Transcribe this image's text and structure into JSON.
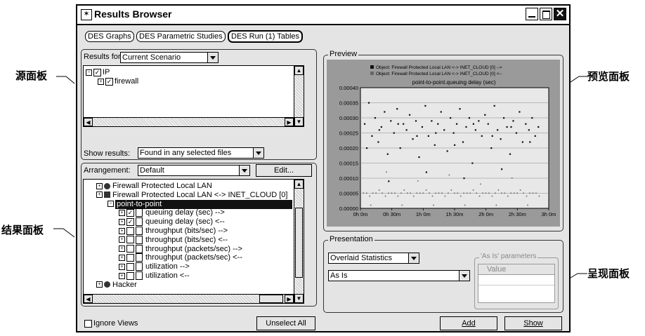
{
  "annotations": {
    "source_panel": "源面板",
    "results_panel": "结果面板",
    "preview_panel": "预览面板",
    "presentation_panel": "呈现面板"
  },
  "window": {
    "title": "Results Browser",
    "close_glyph": "✕"
  },
  "tabs": [
    "DES Graphs",
    "DES Parametric Studies",
    "DES Run (1) Tables"
  ],
  "source": {
    "results_for_label": "Results for:",
    "results_for_value": "Current Scenario",
    "tree": [
      {
        "label": "IP",
        "checked": true,
        "expanded": true,
        "level": 0
      },
      {
        "label": "firewall",
        "checked": true,
        "expanded": false,
        "level": 1
      }
    ],
    "show_results_label": "Show results:",
    "show_results_value": "Found in any selected files"
  },
  "results": {
    "arrangement_label": "Arrangement:",
    "arrangement_value": "Default",
    "edit_button": "Edit...",
    "items": [
      {
        "label": "Firewall Protected Local LAN",
        "level": 0,
        "kind": "node"
      },
      {
        "label": "Firewall Protected Local LAN <-> INET_CLOUD [0]",
        "level": 0,
        "kind": "link"
      },
      {
        "label": "point-to-point",
        "level": 1,
        "kind": "selected"
      },
      {
        "label": "queuing delay (sec) -->",
        "level": 2,
        "checked": true
      },
      {
        "label": "queuing delay (sec) <--",
        "level": 2,
        "checked": true
      },
      {
        "label": "throughput (bits/sec) -->",
        "level": 2,
        "checked": false
      },
      {
        "label": "throughput (bits/sec) <--",
        "level": 2,
        "checked": false
      },
      {
        "label": "throughput (packets/sec) -->",
        "level": 2,
        "checked": false
      },
      {
        "label": "throughput (packets/sec) <--",
        "level": 2,
        "checked": false
      },
      {
        "label": "utilization -->",
        "level": 2,
        "checked": false
      },
      {
        "label": "utilization <--",
        "level": 2,
        "checked": false
      },
      {
        "label": "Hacker",
        "level": 0,
        "kind": "node"
      }
    ],
    "ignore_views_label": "Ignore Views",
    "unselect_all_button": "Unselect All"
  },
  "preview": {
    "group_label": "Preview",
    "legend": [
      "Object: Firewall Protected Local LAN <-> INET_CLOUD [0] -->",
      "Object: Firewall Protected Local LAN <-> INET_CLOUD [0] <--"
    ]
  },
  "chart_data": {
    "type": "scatter",
    "title": "point-to-point.queuing delay (sec)",
    "ylim": [
      0,
      0.0004
    ],
    "yticks": [
      "0.00000",
      "0.00005",
      "0.00010",
      "0.00015",
      "0.00020",
      "0.00025",
      "0.00030",
      "0.00035",
      "0.00040"
    ],
    "xlim": [
      0,
      180
    ],
    "xticks": [
      "0h 0m",
      "0h 30m",
      "1h 0m",
      "1h 30m",
      "2h 0m",
      "2h 30m",
      "3h 0m"
    ],
    "grid": true,
    "legend_placement": "top",
    "series": [
      {
        "name": "Object: Firewall Protected Local LAN <-> INET_CLOUD [0] -->",
        "color": "#111111",
        "points": [
          [
            4,
            0.00028
          ],
          [
            8,
            0.00035
          ],
          [
            11,
            0.00024
          ],
          [
            14,
            0.0003
          ],
          [
            17,
            0.00022
          ],
          [
            20,
            0.00027
          ],
          [
            23,
            0.00032
          ],
          [
            26,
            0.00018
          ],
          [
            29,
            0.00029
          ],
          [
            32,
            0.00025
          ],
          [
            35,
            0.00033
          ],
          [
            38,
            0.0002
          ],
          [
            41,
            0.00028
          ],
          [
            44,
            0.00026
          ],
          [
            47,
            0.00031
          ],
          [
            50,
            0.00023
          ],
          [
            53,
            0.00029
          ],
          [
            56,
            0.00017
          ],
          [
            59,
            0.00027
          ],
          [
            62,
            0.00034
          ],
          [
            65,
            0.00024
          ],
          [
            68,
            0.00029
          ],
          [
            71,
            0.00021
          ],
          [
            74,
            0.00028
          ],
          [
            77,
            0.00032
          ],
          [
            80,
            0.00026
          ],
          [
            83,
            0.00019
          ],
          [
            86,
            0.0003
          ],
          [
            89,
            0.00025
          ],
          [
            92,
            0.00028
          ],
          [
            95,
            0.00033
          ],
          [
            98,
            0.00022
          ],
          [
            101,
            0.00027
          ],
          [
            104,
            0.0003
          ],
          [
            107,
            0.00015
          ],
          [
            110,
            0.00026
          ],
          [
            113,
            0.00029
          ],
          [
            116,
            0.00024
          ],
          [
            119,
            0.00031
          ],
          [
            122,
            0.00028
          ],
          [
            125,
            0.0002
          ],
          [
            128,
            0.00034
          ],
          [
            131,
            0.00026
          ],
          [
            134,
            0.00023
          ],
          [
            137,
            0.0003
          ],
          [
            140,
            0.00027
          ],
          [
            143,
            0.00018
          ],
          [
            146,
            0.00029
          ],
          [
            149,
            0.00025
          ],
          [
            152,
            0.00032
          ],
          [
            155,
            0.00022
          ],
          [
            158,
            0.00028
          ],
          [
            161,
            0.00026
          ],
          [
            164,
            0.0003
          ],
          [
            167,
            0.00024
          ],
          [
            170,
            0.00027
          ],
          [
            6,
            0.0002
          ],
          [
            18,
            0.00026
          ],
          [
            36,
            0.00028
          ],
          [
            54,
            0.00024
          ],
          [
            72,
            0.00025
          ],
          [
            90,
            0.00021
          ],
          [
            108,
            0.00028
          ],
          [
            126,
            0.00024
          ],
          [
            144,
            0.00027
          ],
          [
            162,
            0.00022
          ],
          [
            27,
            9e-05
          ],
          [
            63,
            0.00012
          ],
          [
            99,
            0.0001
          ],
          [
            135,
            0.00013
          ]
        ]
      },
      {
        "name": "Object: Firewall Protected Local LAN <-> INET_CLOUD [0] <--",
        "color": "#666666",
        "points": [
          [
            3,
            5e-05
          ],
          [
            6,
            5e-05
          ],
          [
            9,
            4e-05
          ],
          [
            12,
            5e-05
          ],
          [
            15,
            5e-05
          ],
          [
            18,
            6e-05
          ],
          [
            21,
            5e-05
          ],
          [
            24,
            4e-05
          ],
          [
            27,
            5e-05
          ],
          [
            30,
            5e-05
          ],
          [
            33,
            5e-05
          ],
          [
            36,
            4e-05
          ],
          [
            39,
            5e-05
          ],
          [
            42,
            6e-05
          ],
          [
            45,
            5e-05
          ],
          [
            48,
            5e-05
          ],
          [
            51,
            4e-05
          ],
          [
            54,
            5e-05
          ],
          [
            57,
            5e-05
          ],
          [
            60,
            5e-05
          ],
          [
            63,
            6e-05
          ],
          [
            66,
            5e-05
          ],
          [
            69,
            4e-05
          ],
          [
            72,
            5e-05
          ],
          [
            75,
            5e-05
          ],
          [
            78,
            5e-05
          ],
          [
            81,
            4e-05
          ],
          [
            84,
            5e-05
          ],
          [
            87,
            6e-05
          ],
          [
            90,
            5e-05
          ],
          [
            93,
            5e-05
          ],
          [
            96,
            4e-05
          ],
          [
            99,
            5e-05
          ],
          [
            102,
            5e-05
          ],
          [
            105,
            5e-05
          ],
          [
            108,
            6e-05
          ],
          [
            111,
            5e-05
          ],
          [
            114,
            4e-05
          ],
          [
            117,
            5e-05
          ],
          [
            120,
            5e-05
          ],
          [
            123,
            5e-05
          ],
          [
            126,
            4e-05
          ],
          [
            129,
            5e-05
          ],
          [
            132,
            6e-05
          ],
          [
            135,
            5e-05
          ],
          [
            138,
            5e-05
          ],
          [
            141,
            4e-05
          ],
          [
            144,
            5e-05
          ],
          [
            147,
            5e-05
          ],
          [
            150,
            5e-05
          ],
          [
            153,
            6e-05
          ],
          [
            156,
            5e-05
          ],
          [
            159,
            4e-05
          ],
          [
            162,
            5e-05
          ],
          [
            165,
            5e-05
          ],
          [
            168,
            5e-05
          ],
          [
            171,
            4e-05
          ],
          [
            10,
            1e-05
          ],
          [
            40,
            1e-05
          ],
          [
            70,
            1e-05
          ],
          [
            100,
            1e-05
          ],
          [
            130,
            1e-05
          ],
          [
            160,
            1e-05
          ],
          [
            25,
            0.00012
          ],
          [
            55,
            9e-05
          ],
          [
            85,
            0.00011
          ],
          [
            115,
            8e-05
          ],
          [
            145,
            0.0001
          ]
        ]
      }
    ]
  },
  "presentation": {
    "group_label": "Presentation",
    "statistic_value": "Overlaid Statistics",
    "mode_value": "As Is",
    "params_label": "'As Is' parameters",
    "params_column": "Value",
    "add_button": "Add",
    "show_button": "Show"
  }
}
